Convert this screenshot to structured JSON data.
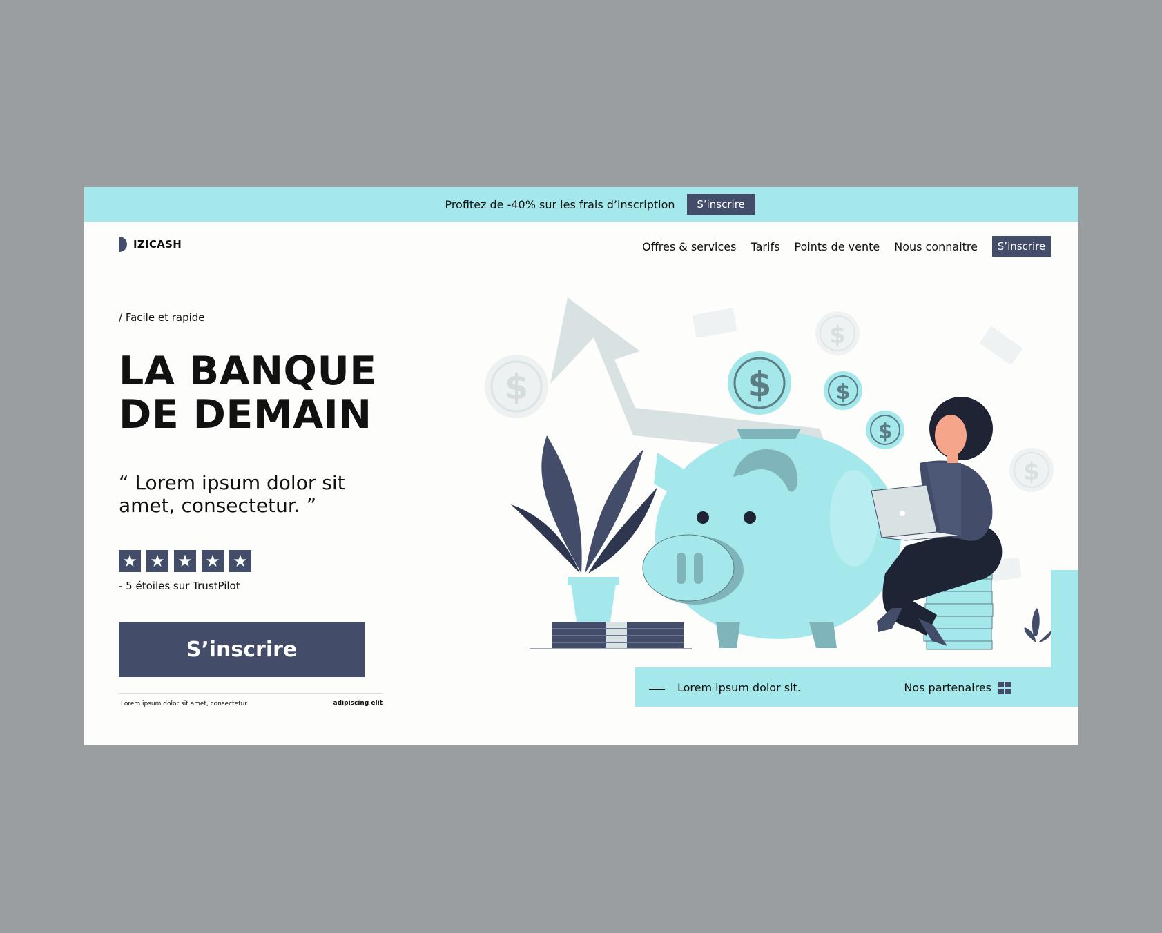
{
  "promo": {
    "text": "Profitez de -40% sur les frais d’inscription",
    "cta": "S’inscrire"
  },
  "brand": {
    "name": "IZICASH"
  },
  "nav": {
    "links": [
      "Offres & services",
      "Tarifs",
      "Points de vente",
      "Nous connaitre"
    ],
    "cta": "S’inscrire"
  },
  "hero": {
    "eyebrow": "/ Facile et rapide",
    "title_line1": "LA BANQUE",
    "title_line2": "DE DEMAIN",
    "quote_line1": "“ Lorem ipsum dolor sit",
    "quote_line2": "amet, consectetur. ”",
    "rating": {
      "stars": 5,
      "icon": "star-icon",
      "caption": "- 5 étoiles sur TrustPilot"
    },
    "cta": "S’inscrire",
    "footer_left": "Lorem ipsum dolor sit amet, consectetur.",
    "footer_right": "adipiscing elit"
  },
  "bottom_bar": {
    "text": "Lorem ipsum dolor sit.",
    "partners": "Nos partenaires",
    "partners_icon": "grid-icon"
  },
  "colors": {
    "accent": "#a5e8ec",
    "dark": "#434d69",
    "background": "#fdfdfb",
    "page_bg": "#9a9ea0"
  }
}
